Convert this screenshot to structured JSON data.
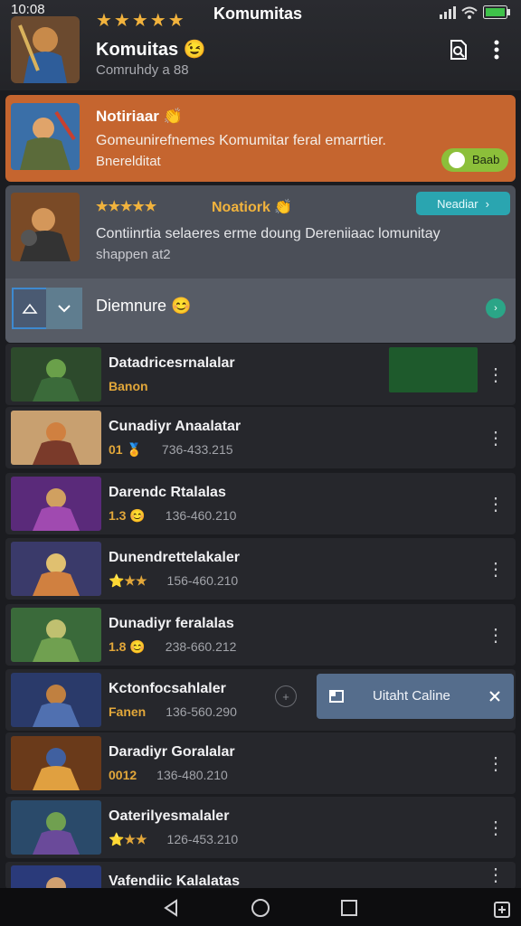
{
  "status": {
    "time": "10:08"
  },
  "header": {
    "top_title": "Komumitas",
    "stars": "★★★★★",
    "title": "Komuitas 😉",
    "subtitle": "Comruhdy a 88"
  },
  "notif_orange": {
    "title": "Notiriaar 👏",
    "body_line1": "Gomeunirefnemes Komumitar feral emarrtier.",
    "body_line2": "Bnerelditat",
    "toggle_label": "Baab"
  },
  "notif_gray": {
    "title_prefix": "★★★★★",
    "title": "Noatiork 👏",
    "body_line1": "Contiinrtia selaeres erme doung Dereniiaac lomunitay",
    "body_line2": "shappen at2",
    "button_label": "Neadiar",
    "section_label": "Diemnure 😊"
  },
  "list": [
    {
      "title": "Datadricesrnalalar",
      "meta1": "Banon",
      "meta2": ""
    },
    {
      "title": "Cunadiyr Anaalatar",
      "meta1": "01 🏅",
      "meta2": "736-433.215"
    },
    {
      "title": "Darendc Rtalalas",
      "meta1": "1.3 😊",
      "meta2": "136-460.210"
    },
    {
      "title": "Dunendrettelakaler",
      "meta1": "⭐★★",
      "meta2": "156-460.210"
    },
    {
      "title": "Dunadiyr feralalas",
      "meta1": "1.8 😊",
      "meta2": "238-660.212"
    },
    {
      "title": "Kctonfocsahlaler",
      "meta1": "Fanen",
      "meta2": "136-560.290"
    },
    {
      "title": "Daradiyr Goralalar",
      "meta1": "0012",
      "meta2": "136-480.210"
    },
    {
      "title": "Oaterilyesmalaler",
      "meta1": "⭐★★",
      "meta2": "126-453.210"
    },
    {
      "title": "Vafendiic Kalalatas",
      "meta1": "",
      "meta2": ""
    }
  ],
  "toast": {
    "label": "Uitaht Caline"
  },
  "colors": {
    "orange": "#c5652f",
    "teal": "#2aa5b0",
    "green": "#8cbf3a",
    "toast": "#556d8c"
  }
}
